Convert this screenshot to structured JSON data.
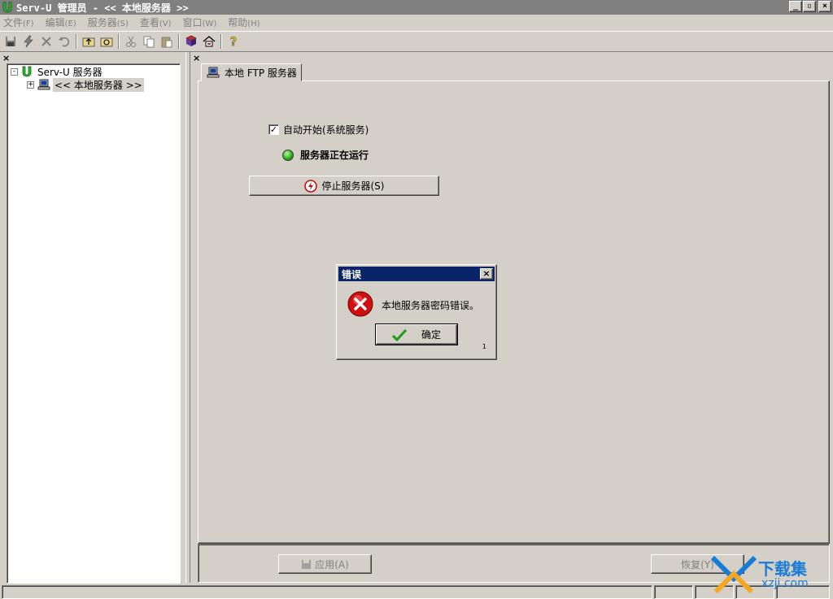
{
  "window": {
    "title": "Serv-U 管理员 - << 本地服务器 >>",
    "controls": [
      "_",
      "▫",
      "×"
    ]
  },
  "menu": [
    {
      "label": "文件",
      "hotkey": "(F)"
    },
    {
      "label": "编辑",
      "hotkey": "(E)"
    },
    {
      "label": "服务器",
      "hotkey": "(S)"
    },
    {
      "label": "查看",
      "hotkey": "(V)"
    },
    {
      "label": "窗口",
      "hotkey": "(W)"
    },
    {
      "label": "帮助",
      "hotkey": "(H)"
    }
  ],
  "toolbar_icons": [
    "save-icon",
    "connect-icon",
    "disconnect-icon",
    "undo-icon",
    "up-folder-icon",
    "refresh-icon",
    "cut-icon",
    "copy-icon",
    "paste-icon",
    "book-icon",
    "home-icon",
    "help-icon"
  ],
  "tree": {
    "close_glyph": "×",
    "root": {
      "label": "Serv-U 服务器",
      "expander": "-"
    },
    "child": {
      "label": "<< 本地服务器 >>",
      "expander": "+"
    }
  },
  "right_panel": {
    "close_glyph": "×",
    "tab_label": "本地 FTP 服务器",
    "autostart_checkbox": {
      "checked_glyph": "✓",
      "label": "自动开始(系统服务)"
    },
    "status_text": "服务器正在运行",
    "stop_button": "停止服务器(S)",
    "apply_button": "应用(A)",
    "restore_button": "恢复(Y)"
  },
  "dialog": {
    "title": "错误",
    "close_glyph": "×",
    "message": "本地服务器密码错误。",
    "ok_button": "确定",
    "corner_number": "1"
  },
  "watermark": {
    "text_cn": "下载集",
    "text_en": "xzji.com"
  },
  "colors": {
    "face": "#d4d0c8",
    "title_inactive": "#808080",
    "dialog_title": "#0a246a",
    "led_green": "#28a315",
    "error_red": "#d01010",
    "watermark_blue": "#1a7bd6"
  }
}
